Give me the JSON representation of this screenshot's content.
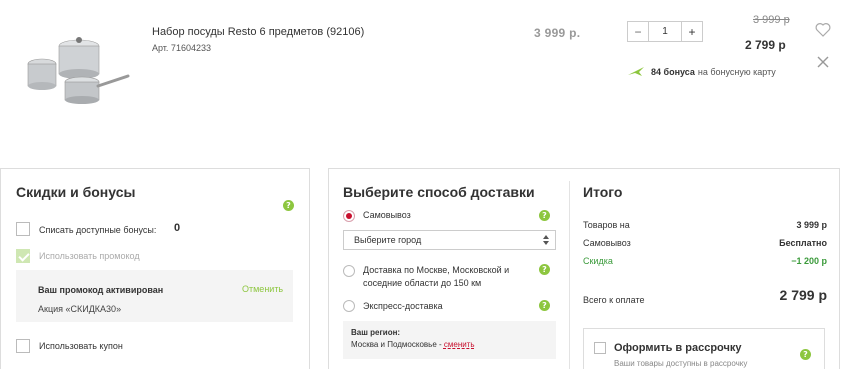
{
  "product": {
    "title": "Набор посуды Resto 6 предметов (92106)",
    "sku": "Арт. 71604233",
    "price": "3 999 р.",
    "quantity": "1",
    "old_price": "3 999 р",
    "new_price": "2 799 р",
    "bonus_amount": "84 бонуса",
    "bonus_text": "на бонусную карту"
  },
  "discounts": {
    "title": "Скидки и бонусы",
    "help": "?",
    "use_bonuses_label": "Списать доступные бонусы:",
    "bonuses_available": "0",
    "use_promo_label": "Использовать промокод",
    "promo_activated": "Ваш промокод активирован",
    "promo_cancel": "Отменить",
    "promo_code": "Акция «СКИДКА30»",
    "use_coupon_label": "Использовать купон"
  },
  "delivery": {
    "title": "Выберите способ доставки",
    "help": "?",
    "options": [
      {
        "label": "Самовывоз",
        "selected": true
      },
      {
        "label": "Доставка по Москве, Московской и соседние области до 150 км",
        "selected": false
      },
      {
        "label": "Экспресс-доставка",
        "selected": false
      }
    ],
    "city_select": "Выберите город",
    "region_title": "Ваш регион:",
    "region_value": "Москва и Подмосковье",
    "region_sep": " - ",
    "region_change": "сменить"
  },
  "summary": {
    "title": "Итого",
    "rows": [
      {
        "label": "Товаров на",
        "value": "3 999 р"
      },
      {
        "label": "Самовывоз",
        "value": "Бесплатно"
      },
      {
        "label": "Скидка",
        "value": "−1 200 р"
      }
    ],
    "total_label": "Всего к оплате",
    "total_value": "2 799 р",
    "installment_title": "Оформить в рассрочку",
    "installment_sub": "Ваши товары доступны в рассрочку"
  },
  "colors": {
    "accent_green": "#8dc63f",
    "accent_red": "#c8102e",
    "discount_green": "#3a9a3a"
  }
}
